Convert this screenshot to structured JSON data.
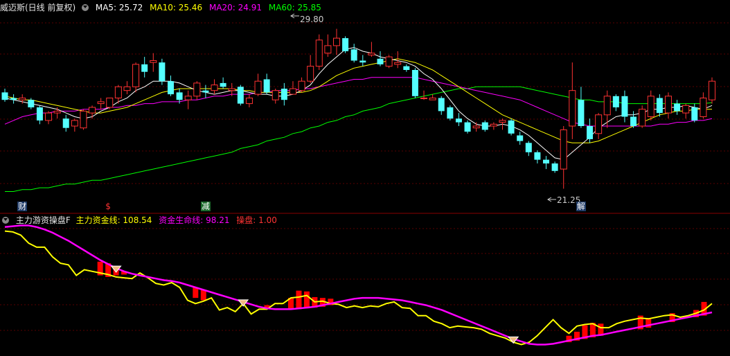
{
  "main_panel": {
    "stock_title": "威迈斯(日线 前复权)",
    "ma_labels": [
      {
        "label": "MA5: 25.72",
        "color": "#ffffff"
      },
      {
        "label": "MA10: 25.46",
        "color": "#ffff00"
      },
      {
        "label": "MA20: 24.91",
        "color": "#ff00ff"
      },
      {
        "label": "MA60: 25.85",
        "color": "#00ff00"
      }
    ],
    "high_label": "29.80",
    "low_label": "21.25",
    "events": [
      {
        "text": "财",
        "color": "#ffffff",
        "bg": "#1e3a66",
        "bar": 2
      },
      {
        "text": "$",
        "color": "#ff3333",
        "bg": "transparent",
        "bar": 12
      },
      {
        "text": "减",
        "color": "#ffffff",
        "bg": "#1c6b2c",
        "bar": 23
      },
      {
        "text": "解",
        "color": "#ffffff",
        "bg": "#1e3a66",
        "bar": 66
      }
    ]
  },
  "sub_panel": {
    "indicator_name": "主力游资操盘F",
    "lines": [
      {
        "label": "主力资金线: 108.54",
        "color": "#ffff00"
      },
      {
        "label": "资金生命线: 98.21",
        "color": "#ff00ff"
      },
      {
        "label": "操盘: 1.00",
        "color": "#ff0000"
      }
    ]
  },
  "colors": {
    "up": "#ff3232",
    "down": "#54ffff",
    "ma5": "#ffffff",
    "ma10": "#ffff00",
    "ma20": "#ff00ff",
    "ma60": "#00ff00",
    "grid": "#5a0000"
  },
  "chart_data": [
    {
      "type": "candlestick",
      "title": "威迈斯(日线 前复权)",
      "ylim": [
        20.6,
        30.6
      ],
      "candles": [
        [
          26.4,
          26.6,
          25.9,
          26.0
        ],
        [
          26.1,
          26.3,
          25.8,
          26.0
        ],
        [
          26.0,
          26.3,
          25.8,
          26.1
        ],
        [
          26.0,
          26.1,
          25.5,
          25.6
        ],
        [
          25.6,
          25.7,
          24.7,
          24.9
        ],
        [
          24.9,
          25.4,
          24.7,
          25.3
        ],
        [
          25.3,
          25.6,
          25.0,
          25.4
        ],
        [
          25.0,
          25.2,
          24.3,
          24.5
        ],
        [
          24.6,
          25.0,
          24.3,
          24.9
        ],
        [
          24.5,
          25.5,
          24.4,
          25.4
        ],
        [
          25.3,
          25.7,
          25.0,
          25.6
        ],
        [
          25.8,
          26.1,
          25.5,
          25.9
        ],
        [
          25.6,
          26.1,
          25.5,
          26.1
        ],
        [
          26.1,
          26.8,
          25.8,
          26.7
        ],
        [
          26.5,
          27.0,
          26.3,
          26.7
        ],
        [
          26.7,
          28.0,
          26.4,
          27.9
        ],
        [
          27.9,
          28.3,
          27.2,
          27.5
        ],
        [
          28.0,
          28.5,
          27.5,
          28.1
        ],
        [
          28.0,
          28.2,
          26.8,
          27.0
        ],
        [
          27.0,
          27.3,
          26.2,
          26.3
        ],
        [
          26.4,
          26.6,
          25.8,
          26.0
        ],
        [
          26.0,
          26.5,
          25.5,
          26.2
        ],
        [
          26.2,
          27.0,
          26.0,
          26.9
        ],
        [
          26.5,
          26.8,
          26.1,
          26.4
        ],
        [
          26.5,
          27.1,
          26.3,
          26.8
        ],
        [
          26.9,
          27.2,
          26.6,
          26.7
        ],
        [
          26.5,
          26.9,
          26.2,
          26.6
        ],
        [
          26.7,
          26.8,
          25.7,
          25.8
        ],
        [
          25.8,
          26.3,
          25.6,
          26.1
        ],
        [
          26.3,
          27.4,
          26.2,
          27.0
        ],
        [
          27.1,
          27.4,
          26.3,
          26.4
        ],
        [
          26.0,
          26.6,
          25.8,
          26.5
        ],
        [
          26.6,
          26.9,
          25.7,
          26.0
        ],
        [
          26.3,
          27.0,
          26.3,
          26.6
        ],
        [
          26.5,
          27.2,
          26.4,
          27.0
        ],
        [
          27.0,
          28.4,
          26.9,
          27.8
        ],
        [
          27.8,
          29.5,
          27.6,
          29.2
        ],
        [
          28.5,
          29.5,
          28.3,
          28.9
        ],
        [
          28.9,
          29.8,
          28.4,
          29.3
        ],
        [
          29.3,
          29.4,
          28.5,
          28.6
        ],
        [
          28.7,
          29.0,
          28.0,
          28.1
        ],
        [
          28.1,
          28.4,
          27.8,
          28.0
        ],
        [
          28.4,
          29.1,
          28.3,
          28.5
        ],
        [
          28.2,
          28.6,
          27.8,
          27.9
        ],
        [
          27.8,
          28.4,
          27.7,
          28.3
        ],
        [
          27.9,
          28.6,
          27.7,
          28.0
        ],
        [
          27.8,
          27.9,
          27.5,
          27.6
        ],
        [
          27.6,
          27.7,
          26.1,
          26.2
        ],
        [
          26.1,
          26.5,
          26.0,
          26.1
        ],
        [
          26.0,
          26.3,
          26.0,
          26.1
        ],
        [
          26.1,
          26.2,
          25.2,
          25.4
        ],
        [
          25.6,
          25.7,
          24.9,
          25.0
        ],
        [
          25.0,
          25.3,
          24.6,
          24.8
        ],
        [
          24.8,
          24.9,
          24.2,
          24.3
        ],
        [
          24.5,
          24.8,
          24.3,
          24.6
        ],
        [
          24.8,
          24.9,
          24.3,
          24.4
        ],
        [
          24.6,
          24.8,
          24.4,
          24.7
        ],
        [
          24.8,
          25.0,
          24.4,
          24.9
        ],
        [
          24.9,
          25.0,
          24.1,
          24.2
        ],
        [
          24.1,
          24.3,
          23.6,
          23.8
        ],
        [
          23.7,
          23.8,
          23.0,
          23.2
        ],
        [
          23.2,
          23.3,
          22.6,
          22.8
        ],
        [
          22.8,
          23.0,
          22.3,
          22.6
        ],
        [
          22.6,
          22.7,
          22.1,
          22.2
        ],
        [
          22.3,
          24.6,
          21.25,
          24.4
        ],
        [
          24.6,
          28.0,
          23.9,
          26.5
        ],
        [
          26.0,
          26.7,
          24.5,
          24.6
        ],
        [
          24.6,
          25.0,
          23.7,
          23.9
        ],
        [
          24.2,
          25.3,
          23.9,
          25.2
        ],
        [
          25.2,
          26.5,
          24.5,
          26.2
        ],
        [
          26.2,
          26.3,
          25.4,
          25.6
        ],
        [
          26.2,
          26.5,
          24.8,
          25.1
        ],
        [
          25.1,
          25.4,
          24.5,
          24.6
        ],
        [
          24.6,
          25.7,
          24.5,
          25.5
        ],
        [
          25.1,
          26.5,
          24.9,
          26.2
        ],
        [
          26.1,
          26.3,
          25.1,
          25.3
        ],
        [
          25.3,
          26.4,
          25.0,
          26.2
        ],
        [
          25.8,
          26.0,
          25.2,
          25.4
        ],
        [
          25.3,
          25.8,
          25.0,
          25.7
        ],
        [
          25.6,
          25.8,
          24.8,
          24.9
        ],
        [
          25.1,
          26.4,
          25.0,
          26.1
        ],
        [
          26.0,
          27.2,
          25.8,
          27.0
        ]
      ],
      "ma5": [
        26.1,
        26.0,
        25.9,
        25.8,
        25.7,
        25.6,
        25.5,
        25.3,
        25.1,
        25.0,
        25.1,
        25.4,
        25.6,
        25.9,
        26.1,
        26.5,
        26.7,
        27.0,
        27.0,
        27.0,
        26.9,
        26.7,
        26.5,
        26.4,
        26.3,
        26.4,
        26.5,
        26.5,
        26.4,
        26.3,
        26.3,
        26.2,
        26.2,
        26.3,
        26.5,
        26.8,
        27.4,
        27.9,
        28.3,
        28.7,
        28.8,
        28.6,
        28.5,
        28.3,
        28.2,
        28.1,
        28.0,
        27.8,
        27.4,
        27.1,
        26.6,
        26.0,
        25.4,
        25.0,
        24.7,
        24.6,
        24.6,
        24.7,
        24.6,
        24.4,
        24.1,
        23.7,
        23.3,
        22.9,
        22.8,
        23.2,
        23.6,
        24.0,
        24.5,
        24.8,
        25.1,
        25.2,
        25.2,
        25.3,
        25.5,
        25.5,
        25.6,
        25.6,
        25.7,
        25.6,
        25.5,
        25.7
      ],
      "ma10": [
        26.2,
        26.1,
        26.0,
        26.0,
        25.9,
        25.8,
        25.7,
        25.6,
        25.5,
        25.4,
        25.3,
        25.3,
        25.4,
        25.5,
        25.6,
        25.8,
        26.0,
        26.2,
        26.4,
        26.5,
        26.6,
        26.6,
        26.6,
        26.6,
        26.6,
        26.6,
        26.6,
        26.5,
        26.5,
        26.4,
        26.4,
        26.4,
        26.4,
        26.4,
        26.4,
        26.5,
        26.7,
        27.0,
        27.3,
        27.5,
        27.7,
        27.8,
        27.9,
        28.0,
        28.1,
        28.2,
        28.1,
        28.0,
        27.8,
        27.6,
        27.3,
        27.0,
        26.7,
        26.4,
        26.1,
        25.8,
        25.5,
        25.2,
        25.0,
        24.8,
        24.6,
        24.4,
        24.2,
        24.0,
        23.8,
        23.7,
        23.7,
        23.7,
        23.8,
        24.0,
        24.2,
        24.4,
        24.6,
        24.8,
        25.0,
        25.2,
        25.3,
        25.4,
        25.4,
        25.5,
        25.5,
        25.5
      ],
      "ma20": [
        24.7,
        24.9,
        25.1,
        25.2,
        25.3,
        25.3,
        25.4,
        25.4,
        25.4,
        25.5,
        25.5,
        25.5,
        25.6,
        25.6,
        25.7,
        25.7,
        25.8,
        25.8,
        25.9,
        25.9,
        25.9,
        26.0,
        26.0,
        26.1,
        26.2,
        26.2,
        26.3,
        26.3,
        26.3,
        26.4,
        26.4,
        26.5,
        26.5,
        26.5,
        26.6,
        26.6,
        26.7,
        26.8,
        26.9,
        27.0,
        27.1,
        27.1,
        27.2,
        27.2,
        27.2,
        27.2,
        27.2,
        27.2,
        27.1,
        27.0,
        26.9,
        26.8,
        26.7,
        26.6,
        26.5,
        26.4,
        26.3,
        26.2,
        26.1,
        26.0,
        25.8,
        25.6,
        25.4,
        25.2,
        25.0,
        24.8,
        24.7,
        24.6,
        24.6,
        24.6,
        24.6,
        24.6,
        24.6,
        24.6,
        24.6,
        24.7,
        24.7,
        24.8,
        24.8,
        24.9,
        24.9,
        25.0
      ],
      "ma60": [
        21.1,
        21.1,
        21.2,
        21.2,
        21.3,
        21.3,
        21.4,
        21.5,
        21.5,
        21.6,
        21.7,
        21.7,
        21.8,
        21.9,
        22.0,
        22.1,
        22.2,
        22.3,
        22.4,
        22.5,
        22.6,
        22.7,
        22.8,
        22.9,
        23.0,
        23.1,
        23.2,
        23.4,
        23.5,
        23.6,
        23.8,
        23.9,
        24.0,
        24.2,
        24.3,
        24.5,
        24.6,
        24.8,
        24.9,
        25.1,
        25.2,
        25.4,
        25.5,
        25.6,
        25.8,
        25.9,
        26.0,
        26.1,
        26.2,
        26.3,
        26.4,
        26.5,
        26.6,
        26.6,
        26.7,
        26.7,
        26.7,
        26.7,
        26.7,
        26.7,
        26.6,
        26.5,
        26.4,
        26.3,
        26.2,
        26.1,
        26.0,
        26.0,
        25.9,
        25.9,
        25.9,
        25.8,
        25.8,
        25.8,
        25.8,
        25.8,
        25.8,
        25.8,
        25.8,
        25.8,
        25.8,
        25.85
      ]
    },
    {
      "type": "line+bar",
      "title": "主力游资操盘F",
      "ylim": [
        0,
        160
      ],
      "series": [
        {
          "name": "主力资金线",
          "values": [
            150,
            149,
            145,
            135,
            130,
            130,
            118,
            110,
            108,
            95,
            102,
            100,
            98,
            96,
            93,
            92,
            91,
            98,
            92,
            85,
            83,
            86,
            80,
            64,
            60,
            63,
            67,
            52,
            55,
            50,
            60,
            47,
            53,
            53,
            60,
            60,
            67,
            68,
            70,
            62,
            63,
            60,
            59,
            55,
            57,
            55,
            57,
            56,
            60,
            62,
            55,
            54,
            45,
            45,
            38,
            35,
            30,
            32,
            31,
            30,
            28,
            23,
            20,
            17,
            12,
            9,
            12,
            20,
            30,
            40,
            30,
            23,
            32,
            34,
            35,
            30,
            30,
            35,
            38,
            40,
            42,
            41,
            43,
            45,
            46,
            43,
            45,
            48,
            52,
            60
          ]
        },
        {
          "name": "资金生命线",
          "values": [
            155,
            156,
            157,
            157,
            155,
            152,
            148,
            143,
            138,
            132,
            126,
            120,
            114,
            109,
            104,
            100,
            97,
            95,
            93,
            91,
            89,
            88,
            86,
            83,
            80,
            77,
            74,
            71,
            68,
            65,
            62,
            59,
            56,
            54,
            53,
            53,
            53,
            54,
            55,
            56,
            58,
            60,
            62,
            64,
            66,
            67,
            67,
            67,
            66,
            65,
            64,
            62,
            60,
            58,
            55,
            52,
            48,
            44,
            40,
            36,
            32,
            28,
            24,
            20,
            16,
            13,
            10,
            9,
            9,
            10,
            12,
            14,
            16,
            18,
            20,
            21,
            23,
            25,
            27,
            29,
            31,
            33,
            35,
            37,
            39,
            41,
            43,
            45,
            47,
            49
          ]
        },
        {
          "name": "操盘",
          "bars": [
            [
              12,
              112,
              95
            ],
            [
              13,
              110,
              93
            ],
            [
              14,
              105,
              95
            ],
            [
              15,
              100,
              96
            ],
            [
              24,
              80,
              67
            ],
            [
              25,
              77,
              64
            ],
            [
              33,
              58,
              54
            ],
            [
              36,
              67,
              53
            ],
            [
              37,
              76,
              53
            ],
            [
              38,
              75,
              54
            ],
            [
              39,
              68,
              55
            ],
            [
              40,
              67,
              56
            ],
            [
              41,
              66,
              58
            ],
            [
              71,
              20,
              12
            ],
            [
              72,
              25,
              14
            ],
            [
              73,
              33,
              16
            ],
            [
              74,
              36,
              18
            ],
            [
              75,
              35,
              20
            ],
            [
              80,
              45,
              28
            ],
            [
              81,
              42,
              30
            ],
            [
              84,
              48,
              37
            ],
            [
              87,
              52,
              43
            ],
            [
              88,
              62,
              45
            ]
          ]
        }
      ],
      "signals": [
        14,
        30,
        64
      ]
    }
  ]
}
